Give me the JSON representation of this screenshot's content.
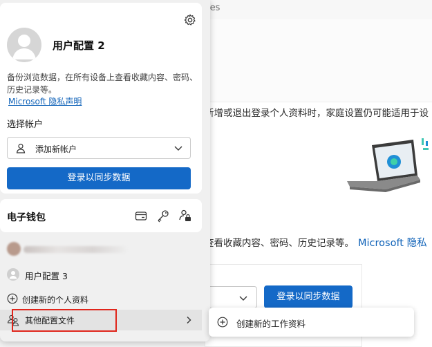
{
  "background": {
    "tab_text": "les",
    "family_line": "新增或退出登录个人资料时，家庭设置仍可能适用于设",
    "backup_line": "查看收藏内容、密码、历史记录等。",
    "backup_link": "Microsoft 隐私",
    "sync_button": "登录以同步数据"
  },
  "profile_card": {
    "name": "用户配置 2",
    "description": "备份浏览数据，在所有设备上查看收藏内容、密码、历史记录等。",
    "privacy_link": "Microsoft 隐私声明",
    "choose_account_label": "选择帐户",
    "account_select_value": "添加新帐户",
    "sync_button": "登录以同步数据"
  },
  "wallet": {
    "title": "电子钱包"
  },
  "profiles_list": {
    "profile3": "用户配置 3",
    "create_profile": "创建新的个人资料",
    "other_profiles": "其他配置文件"
  },
  "submenu": {
    "create_work_profile": "创建新的工作资料"
  },
  "colors": {
    "accent": "#1469c7",
    "link": "#0f62b8",
    "highlight": "#e0251b"
  }
}
